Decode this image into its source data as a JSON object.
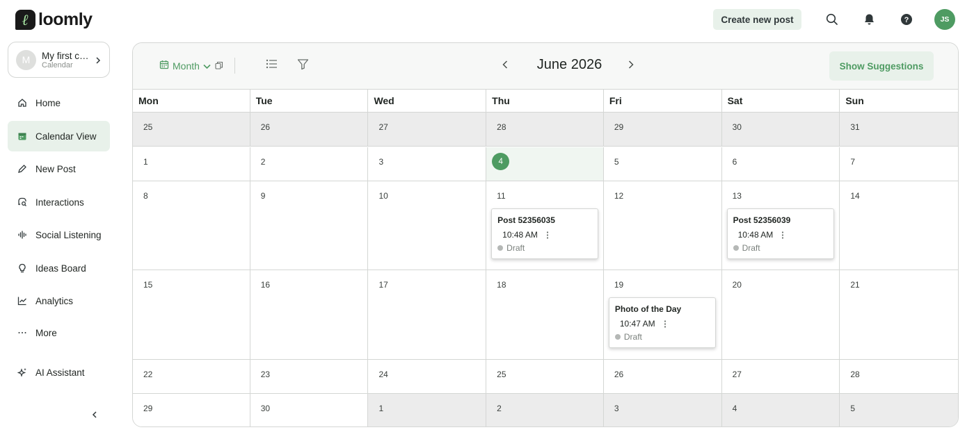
{
  "logo": {
    "text": "loomly",
    "mark_letter": "ℓ"
  },
  "header": {
    "create_label": "Create new post",
    "avatar_initials": "JS"
  },
  "sidebar": {
    "calendar": {
      "initial": "M",
      "name": "My first ca...",
      "sub": "Calendar"
    },
    "items": [
      {
        "label": "Home",
        "icon": "home-icon"
      },
      {
        "label": "Calendar View",
        "icon": "calendar-icon",
        "active": true
      },
      {
        "label": "New Post",
        "icon": "pencil-icon"
      },
      {
        "label": "Interactions",
        "icon": "chat-search-icon"
      },
      {
        "label": "Social Listening",
        "icon": "soundwave-icon"
      },
      {
        "label": "Ideas Board",
        "icon": "lightbulb-icon"
      },
      {
        "label": "Analytics",
        "icon": "chart-line-icon"
      },
      {
        "label": "More",
        "icon": "ellipsis-icon"
      },
      {
        "label": "AI Assistant",
        "icon": "sparkles-icon"
      }
    ]
  },
  "toolbar": {
    "view_label": "Month",
    "month_title": "June 2026",
    "suggestions_label": "Show Suggestions"
  },
  "calendar": {
    "weekdays": [
      "Mon",
      "Tue",
      "Wed",
      "Thu",
      "Fri",
      "Sat",
      "Sun"
    ],
    "today": 4,
    "weeks": [
      {
        "days": [
          "25",
          "26",
          "27",
          "28",
          "29",
          "30",
          "31"
        ],
        "out": [
          true,
          true,
          true,
          true,
          true,
          true,
          true
        ]
      },
      {
        "days": [
          "1",
          "2",
          "3",
          "4",
          "5",
          "6",
          "7"
        ],
        "out": [
          false,
          false,
          false,
          false,
          false,
          false,
          false
        ]
      },
      {
        "days": [
          "8",
          "9",
          "10",
          "11",
          "12",
          "13",
          "14"
        ],
        "out": [
          false,
          false,
          false,
          false,
          false,
          false,
          false
        ]
      },
      {
        "days": [
          "15",
          "16",
          "17",
          "18",
          "19",
          "20",
          "21"
        ],
        "out": [
          false,
          false,
          false,
          false,
          false,
          false,
          false
        ]
      },
      {
        "days": [
          "22",
          "23",
          "24",
          "25",
          "26",
          "27",
          "28"
        ],
        "out": [
          false,
          false,
          false,
          false,
          false,
          false,
          false
        ]
      },
      {
        "days": [
          "29",
          "30",
          "1",
          "2",
          "3",
          "4",
          "5"
        ],
        "out": [
          false,
          false,
          true,
          true,
          true,
          true,
          true
        ]
      }
    ],
    "posts": [
      {
        "week": 2,
        "day": 3,
        "title": "Post 52356035",
        "time": "10:48 AM",
        "status": "Draft"
      },
      {
        "week": 2,
        "day": 5,
        "title": "Post 52356039",
        "time": "10:48 AM",
        "status": "Draft"
      },
      {
        "week": 3,
        "day": 4,
        "title": "Photo of the Day",
        "time": "10:47 AM",
        "status": "Draft"
      }
    ]
  },
  "colors": {
    "accent": "#4e9b62",
    "accent_light": "#e8f1ea",
    "out_of_month": "#ececec",
    "draft_dot": "#b5b8b6"
  }
}
